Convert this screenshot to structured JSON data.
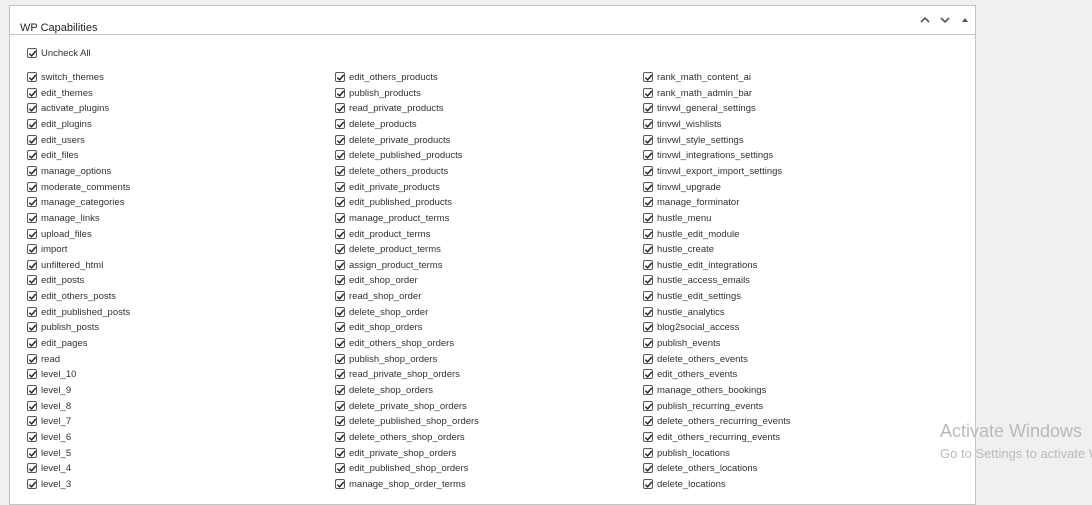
{
  "panel": {
    "title": "WP Capabilities",
    "uncheck_all_label": "Uncheck All"
  },
  "icons": {
    "collapse_up": "chevron-up-icon",
    "collapse_down": "chevron-down-icon",
    "toggle": "triangle-up-icon",
    "checkbox": "checkmark-icon"
  },
  "colors": {
    "check": "#1d2327",
    "border": "#c3c4c7",
    "background": "#f0f0f1"
  },
  "columns": [
    [
      "switch_themes",
      "edit_themes",
      "activate_plugins",
      "edit_plugins",
      "edit_users",
      "edit_files",
      "manage_options",
      "moderate_comments",
      "manage_categories",
      "manage_links",
      "upload_files",
      "import",
      "unfiltered_html",
      "edit_posts",
      "edit_others_posts",
      "edit_published_posts",
      "publish_posts",
      "edit_pages",
      "read",
      "level_10",
      "level_9",
      "level_8",
      "level_7",
      "level_6",
      "level_5",
      "level_4",
      "level_3"
    ],
    [
      "edit_others_products",
      "publish_products",
      "read_private_products",
      "delete_products",
      "delete_private_products",
      "delete_published_products",
      "delete_others_products",
      "edit_private_products",
      "edit_published_products",
      "manage_product_terms",
      "edit_product_terms",
      "delete_product_terms",
      "assign_product_terms",
      "edit_shop_order",
      "read_shop_order",
      "delete_shop_order",
      "edit_shop_orders",
      "edit_others_shop_orders",
      "publish_shop_orders",
      "read_private_shop_orders",
      "delete_shop_orders",
      "delete_private_shop_orders",
      "delete_published_shop_orders",
      "delete_others_shop_orders",
      "edit_private_shop_orders",
      "edit_published_shop_orders",
      "manage_shop_order_terms"
    ],
    [
      "rank_math_content_ai",
      "rank_math_admin_bar",
      "tinvwl_general_settings",
      "tinvwl_wishlists",
      "tinvwl_style_settings",
      "tinvwl_integrations_settings",
      "tinvwl_export_import_settings",
      "tinvwl_upgrade",
      "manage_forminator",
      "hustle_menu",
      "hustle_edit_module",
      "hustle_create",
      "hustle_edit_integrations",
      "hustle_access_emails",
      "hustle_edit_settings",
      "hustle_analytics",
      "blog2social_access",
      "publish_events",
      "delete_others_events",
      "edit_others_events",
      "manage_others_bookings",
      "publish_recurring_events",
      "delete_others_recurring_events",
      "edit_others_recurring_events",
      "publish_locations",
      "delete_others_locations",
      "delete_locations"
    ]
  ],
  "watermark": {
    "line1": "Activate Windows",
    "line2": "Go to Settings to activate Windows."
  }
}
